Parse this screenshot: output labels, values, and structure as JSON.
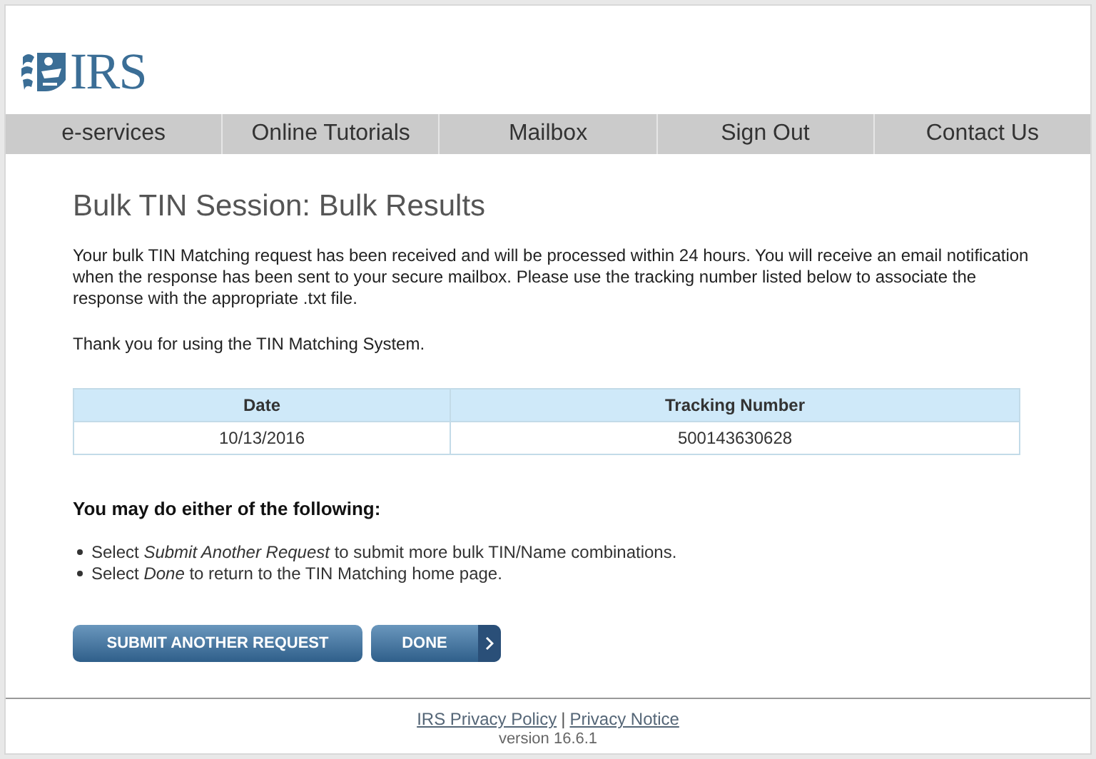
{
  "logo": {
    "text": "IRS"
  },
  "nav": [
    {
      "label": "e-services"
    },
    {
      "label": "Online Tutorials"
    },
    {
      "label": "Mailbox"
    },
    {
      "label": "Sign Out"
    },
    {
      "label": "Contact Us"
    }
  ],
  "title": "Bulk TIN Session: Bulk Results",
  "paragraphs": [
    "Your bulk TIN Matching request has been received and will be processed within 24 hours. You will receive an email notification when the response has been sent to your secure mailbox. Please use the tracking number listed below to associate the response with the appropriate .txt file.",
    "Thank you for using the TIN Matching System."
  ],
  "table": {
    "columns": [
      "Date",
      "Tracking Number"
    ],
    "rows": [
      [
        "10/13/2016",
        "500143630628"
      ]
    ]
  },
  "options_heading": "You may do either of the following:",
  "options": [
    "Select *Submit Another Request* to submit more bulk TIN/Name combinations.",
    "Select *Done* to return to the TIN Matching home page."
  ],
  "buttons": [
    {
      "label": "SUBMIT ANOTHER REQUEST",
      "kind": "plain"
    },
    {
      "label": "DONE",
      "kind": "arrow"
    }
  ],
  "footer": {
    "links": [
      "IRS Privacy Policy",
      "Privacy Notice"
    ],
    "separator": "|",
    "version": "version 16.6.1"
  }
}
